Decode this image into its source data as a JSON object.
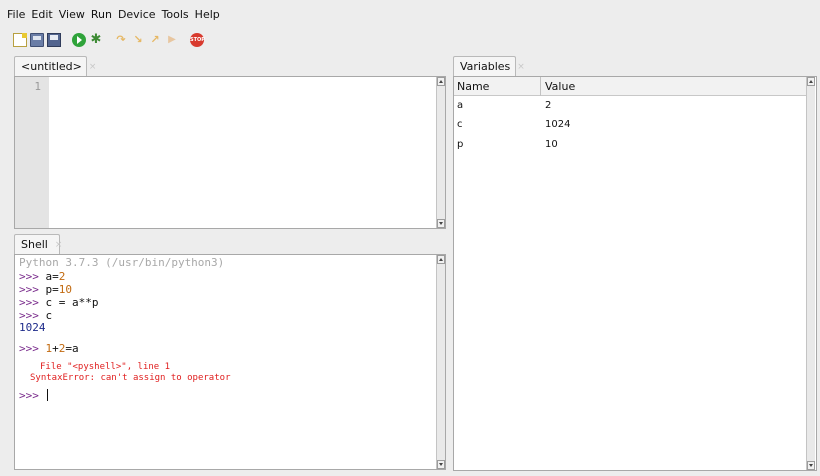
{
  "menu": [
    "File",
    "Edit",
    "View",
    "Run",
    "Device",
    "Tools",
    "Help"
  ],
  "toolbar": {
    "icons": [
      "new-file-icon",
      "open-file-icon",
      "save-file-icon",
      "run-icon",
      "debug-icon",
      "step-over-icon",
      "step-into-icon",
      "step-out-icon",
      "resume-icon",
      "stop-icon"
    ],
    "stop_text": "STOP"
  },
  "editor": {
    "tab_label": "<untitled>",
    "tab_close": "×",
    "line_numbers": [
      "1"
    ]
  },
  "shell": {
    "tab_label": "Shell",
    "tab_close": "×",
    "banner": "Python 3.7.3 (/usr/bin/python3)",
    "prompt": ">>>",
    "cmd1_name": "a",
    "cmd1_op": "=",
    "cmd1_val": "2",
    "cmd2_name": "p",
    "cmd2_op": "=",
    "cmd2_val": "10",
    "cmd3": "c = a**p",
    "cmd4": "c",
    "out4": "1024",
    "cmd5_a": "1",
    "cmd5_b": "+",
    "cmd5_c": "2",
    "cmd5_d": "=a",
    "err_line1": "File \"<pyshell>\", line 1",
    "err_line2": "SyntaxError: can't assign to operator"
  },
  "variables": {
    "tab_label": "Variables",
    "tab_close": "×",
    "columns": [
      "Name",
      "Value"
    ],
    "rows": [
      {
        "name": "a",
        "value": "2"
      },
      {
        "name": "c",
        "value": "1024"
      },
      {
        "name": "p",
        "value": "10"
      }
    ]
  },
  "colors": {
    "background": "#ededed",
    "prompt": "#7a2c8c",
    "number": "#c26a10",
    "output": "#1d2a8a",
    "error": "#e02020"
  }
}
